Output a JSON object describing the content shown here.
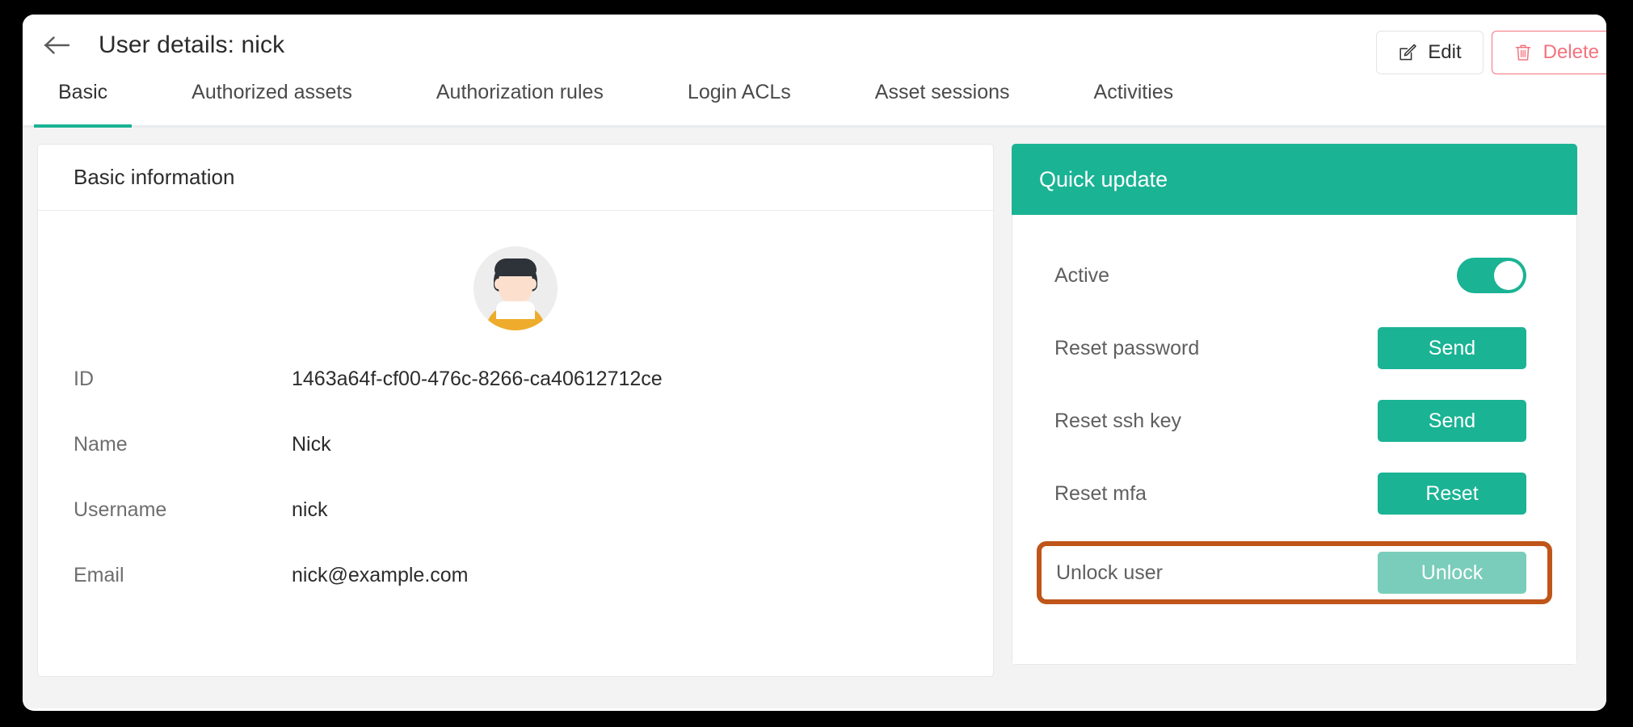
{
  "header": {
    "back_icon": "arrow-left-icon",
    "title": "User details: nick",
    "edit_label": "Edit",
    "edit_icon": "pencil-square-icon",
    "delete_label": "Delete",
    "delete_icon": "trash-icon"
  },
  "tabs": [
    {
      "label": "Basic",
      "active": true
    },
    {
      "label": "Authorized assets",
      "active": false
    },
    {
      "label": "Authorization rules",
      "active": false
    },
    {
      "label": "Login ACLs",
      "active": false
    },
    {
      "label": "Asset sessions",
      "active": false
    },
    {
      "label": "Activities",
      "active": false
    }
  ],
  "basic_panel": {
    "title": "Basic information",
    "avatar": "user-avatar",
    "fields": [
      {
        "label": "ID",
        "value": "1463a64f-cf00-476c-8266-ca40612712ce"
      },
      {
        "label": "Name",
        "value": "Nick"
      },
      {
        "label": "Username",
        "value": "nick"
      },
      {
        "label": "Email",
        "value": "nick@example.com"
      }
    ]
  },
  "quick_update": {
    "title": "Quick update",
    "rows": [
      {
        "label": "Active",
        "control": "toggle",
        "state": "on"
      },
      {
        "label": "Reset password",
        "control": "button",
        "button_label": "Send"
      },
      {
        "label": "Reset ssh key",
        "control": "button",
        "button_label": "Send"
      },
      {
        "label": "Reset mfa",
        "control": "button",
        "button_label": "Reset"
      },
      {
        "label": "Unlock user",
        "control": "button",
        "button_label": "Unlock",
        "highlighted": true
      }
    ]
  },
  "colors": {
    "accent_teal": "#1ab394",
    "muted_teal": "#79cdba",
    "danger_red": "#f3737e",
    "highlight_orange": "#c0551a",
    "page_bg": "#f3f3f4",
    "window_bg": "#ffffff"
  }
}
